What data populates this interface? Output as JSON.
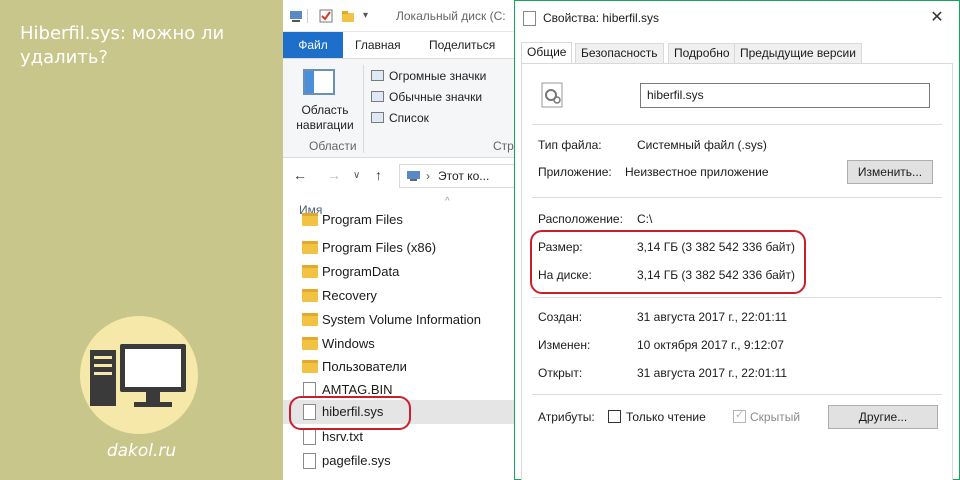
{
  "banner": {
    "title": "Hiberfil.sys: можно ли удалить?",
    "site": "dakol.ru",
    "accent_color": "#c9c68c"
  },
  "explorer": {
    "window_title": "Локальный диск (С:",
    "ribbon_tabs": [
      "Файл",
      "Главная",
      "Поделиться"
    ],
    "nav_pane_label": "Область навигации",
    "section_panes": "Области",
    "section_structure": "Стру",
    "view_options": [
      "Огромные значки",
      "Обычные значки",
      "Список"
    ],
    "address": "Этот ко...",
    "column_name": "Имя",
    "files": [
      {
        "name": "Program Files",
        "type": "folder"
      },
      {
        "name": "Program Files (x86)",
        "type": "folder"
      },
      {
        "name": "ProgramData",
        "type": "folder"
      },
      {
        "name": "Recovery",
        "type": "folder"
      },
      {
        "name": "System Volume Information",
        "type": "folder"
      },
      {
        "name": "Windows",
        "type": "folder"
      },
      {
        "name": "Пользователи",
        "type": "folder"
      },
      {
        "name": "AMTAG.BIN",
        "type": "file"
      },
      {
        "name": "hiberfil.sys",
        "type": "file"
      },
      {
        "name": "hsrv.txt",
        "type": "file"
      },
      {
        "name": "pagefile.sys",
        "type": "file"
      }
    ]
  },
  "dialog": {
    "title": "Свойства: hiberfil.sys",
    "tabs": [
      "Общие",
      "Безопасность",
      "Подробно",
      "Предыдущие версии"
    ],
    "file_name": "hiberfil.sys",
    "file_type_label": "Тип файла:",
    "file_type": "Системный файл (.sys)",
    "app_label": "Приложение:",
    "app": "Неизвестное приложение",
    "change_button": "Изменить...",
    "location_label": "Расположение:",
    "location": "C:\\",
    "size_label": "Размер:",
    "size": "3,14 ГБ (3 382 542 336 байт)",
    "disk_label": "На диске:",
    "disk": "3,14 ГБ (3 382 542 336 байт)",
    "created_label": "Создан:",
    "created": "31 августа 2017 г., 22:01:11",
    "modified_label": "Изменен:",
    "modified": "10 октября 2017 г., 9:12:07",
    "opened_label": "Открыт:",
    "opened": "31 августа 2017 г., 22:01:11",
    "attributes_label": "Атрибуты:",
    "readonly_label": "Только чтение",
    "hidden_label": "Скрытый",
    "other_button": "Другие...",
    "highlight_color": "#c8202d"
  }
}
